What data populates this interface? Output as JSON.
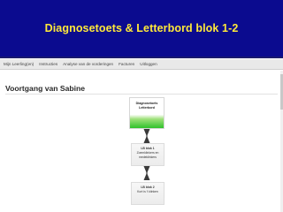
{
  "header": {
    "title": "Diagnosetoets & Letterbord blok 1-2",
    "bg_color": "#0b0b8f",
    "title_color": "#ffe93a"
  },
  "nav": {
    "items": [
      {
        "label": "Mijn Leerling(en)"
      },
      {
        "label": "Instructies"
      },
      {
        "label": "Analyse van de vorderingen"
      },
      {
        "label": "Facturen"
      },
      {
        "label": "Uitloggen"
      }
    ]
  },
  "page": {
    "title": "Voortgang van Sabine"
  },
  "progress": {
    "active_color": "#2fc12b",
    "steps": [
      {
        "line1": "Diagnosetoets",
        "line2": "Letterbord",
        "line3": "",
        "state": "active"
      },
      {
        "line1": "LB blok 1",
        "line2": "Zoemklinkers en",
        "line3": "medeklinkers",
        "state": "inactive"
      },
      {
        "line1": "LB blok 2",
        "line2": "Kort is 't klinken",
        "line3": "",
        "state": "inactive"
      }
    ]
  }
}
